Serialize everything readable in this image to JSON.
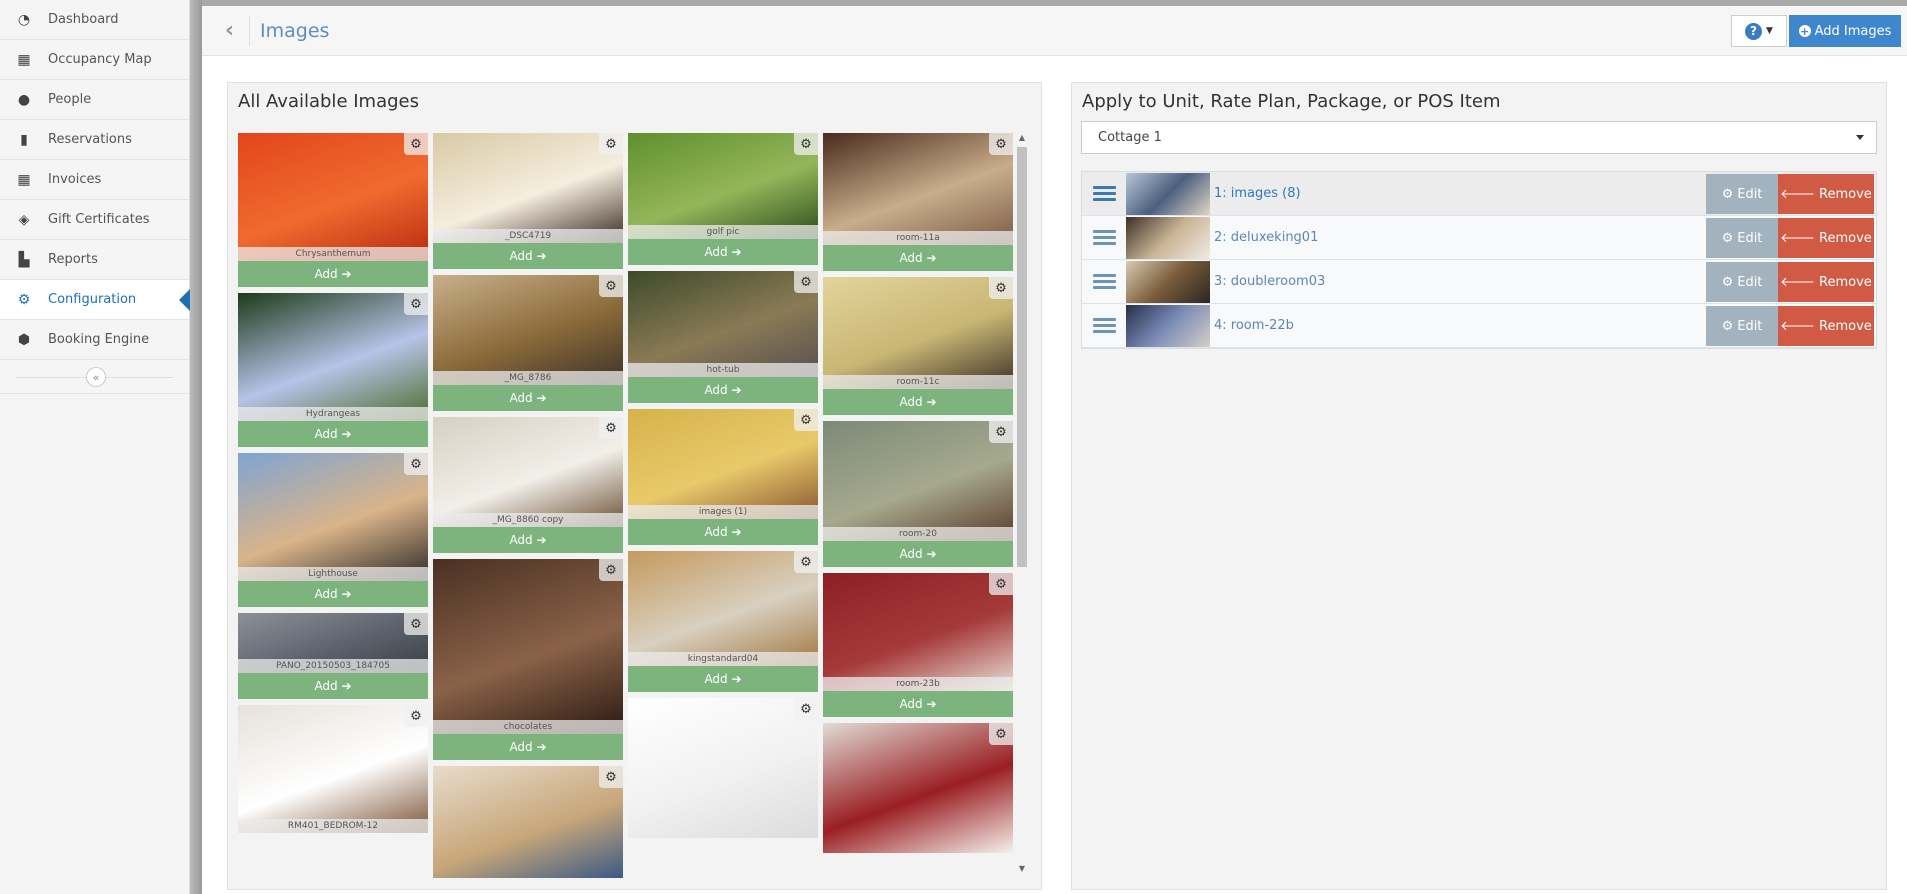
{
  "sidebar": {
    "items": [
      {
        "label": "Dashboard",
        "icon": "dashboard-icon",
        "glyph": "◔"
      },
      {
        "label": "Occupancy Map",
        "icon": "calendar-icon",
        "glyph": "▦"
      },
      {
        "label": "People",
        "icon": "user-icon",
        "glyph": "●"
      },
      {
        "label": "Reservations",
        "icon": "suitcase-icon",
        "glyph": "▮"
      },
      {
        "label": "Invoices",
        "icon": "table-icon",
        "glyph": "▦"
      },
      {
        "label": "Gift Certificates",
        "icon": "ticket-icon",
        "glyph": "◈"
      },
      {
        "label": "Reports",
        "icon": "bar-chart-icon",
        "glyph": "▙"
      },
      {
        "label": "Configuration",
        "icon": "gears-icon",
        "glyph": "⚙",
        "active": true
      },
      {
        "label": "Booking Engine",
        "icon": "cube-icon",
        "glyph": "⬢"
      }
    ],
    "collapse_glyph": "«"
  },
  "header": {
    "back_glyph": "‹",
    "title": "Images",
    "help_glyph": "?",
    "add_images_label": "Add Images"
  },
  "left_panel": {
    "title": "All Available Images",
    "add_label": "Add ➔",
    "columns": [
      [
        {
          "name": "Chrysanthemum",
          "colors": [
            "#e2461c",
            "#f06a2e",
            "#b82a10"
          ]
        },
        {
          "name": "Hydrangeas",
          "colors": [
            "#1d3a18",
            "#b7c3e8",
            "#4c6b2b"
          ]
        },
        {
          "name": "Lighthouse",
          "colors": [
            "#7fa4d1",
            "#d9b48a",
            "#2e2a25"
          ]
        },
        {
          "name": "PANO_20150503_184705",
          "colors": [
            "#8d9099",
            "#5c626c",
            "#3a3f44"
          ]
        },
        {
          "name": "RM401_BEDROM-12",
          "colors": [
            "#e6e1da",
            "#ffffff",
            "#7b5434"
          ]
        }
      ],
      [
        {
          "name": "_DSC4719",
          "colors": [
            "#d9c9a4",
            "#f5eedf",
            "#3a2a20"
          ]
        },
        {
          "name": "_MG_8786",
          "colors": [
            "#c9b08a",
            "#8a6a3a",
            "#3d3228"
          ]
        },
        {
          "name": "_MG_8860 copy",
          "colors": [
            "#d7cfc2",
            "#f2efe9",
            "#6b4f34"
          ]
        },
        {
          "name": "chocolates",
          "colors": [
            "#4a3023",
            "#8a6248",
            "#2a1912"
          ]
        },
        {
          "name": "",
          "colors": [
            "#e8dccb",
            "#c7a679",
            "#2b5286"
          ]
        }
      ],
      [
        {
          "name": "golf pic",
          "colors": [
            "#5f8f2e",
            "#94b65a",
            "#2c4d1a"
          ]
        },
        {
          "name": "hot-tub",
          "colors": [
            "#3e4a2a",
            "#8a7a55",
            "#585050"
          ]
        },
        {
          "name": "images (1)",
          "colors": [
            "#d7b24a",
            "#e8c96a",
            "#8a5530"
          ]
        },
        {
          "name": "kingstandard04",
          "colors": [
            "#c59a5c",
            "#d8d0c0",
            "#a07840"
          ]
        },
        {
          "name": "",
          "colors": [
            "#ffffff",
            "#f1f1f1",
            "#dcdcdc"
          ]
        }
      ],
      [
        {
          "name": "room-11a",
          "colors": [
            "#4a2a1e",
            "#c9ad8a",
            "#7a5a45"
          ]
        },
        {
          "name": "room-11c",
          "colors": [
            "#e3d49a",
            "#c8b674",
            "#3b2f24"
          ]
        },
        {
          "name": "room-20",
          "colors": [
            "#7c8a78",
            "#a6a98e",
            "#5a3a2a"
          ]
        },
        {
          "name": "room-23b",
          "colors": [
            "#8c1f24",
            "#a53a3a",
            "#e9e3dc"
          ]
        },
        {
          "name": "",
          "colors": [
            "#e0dcd6",
            "#9a1e22",
            "#f4f1ec"
          ]
        }
      ]
    ]
  },
  "right_panel": {
    "title": "Apply to Unit, Rate Plan, Package, or POS Item",
    "selected_unit": "Cottage 1",
    "edit_label": "Edit",
    "remove_label": "Remove",
    "assigned": [
      {
        "label": "1: images (8)",
        "colors": [
          "#b9c6d6",
          "#4a5f7e",
          "#e0d6c4"
        ]
      },
      {
        "label": "2: deluxeking01",
        "colors": [
          "#3a3028",
          "#c9b294",
          "#f0ece6"
        ]
      },
      {
        "label": "3: doubleroom03",
        "colors": [
          "#d7cbb3",
          "#7a5c3a",
          "#2a2622"
        ]
      },
      {
        "label": "4: room-22b",
        "colors": [
          "#24304a",
          "#7b8bb8",
          "#d5cfc5"
        ]
      }
    ]
  },
  "colors": {
    "accent": "#1e6fb6",
    "add_button": "#7db47e",
    "add_images_button": "#3f87cc",
    "edit_button": "#a2b3bf",
    "remove_button": "#d15a44"
  }
}
